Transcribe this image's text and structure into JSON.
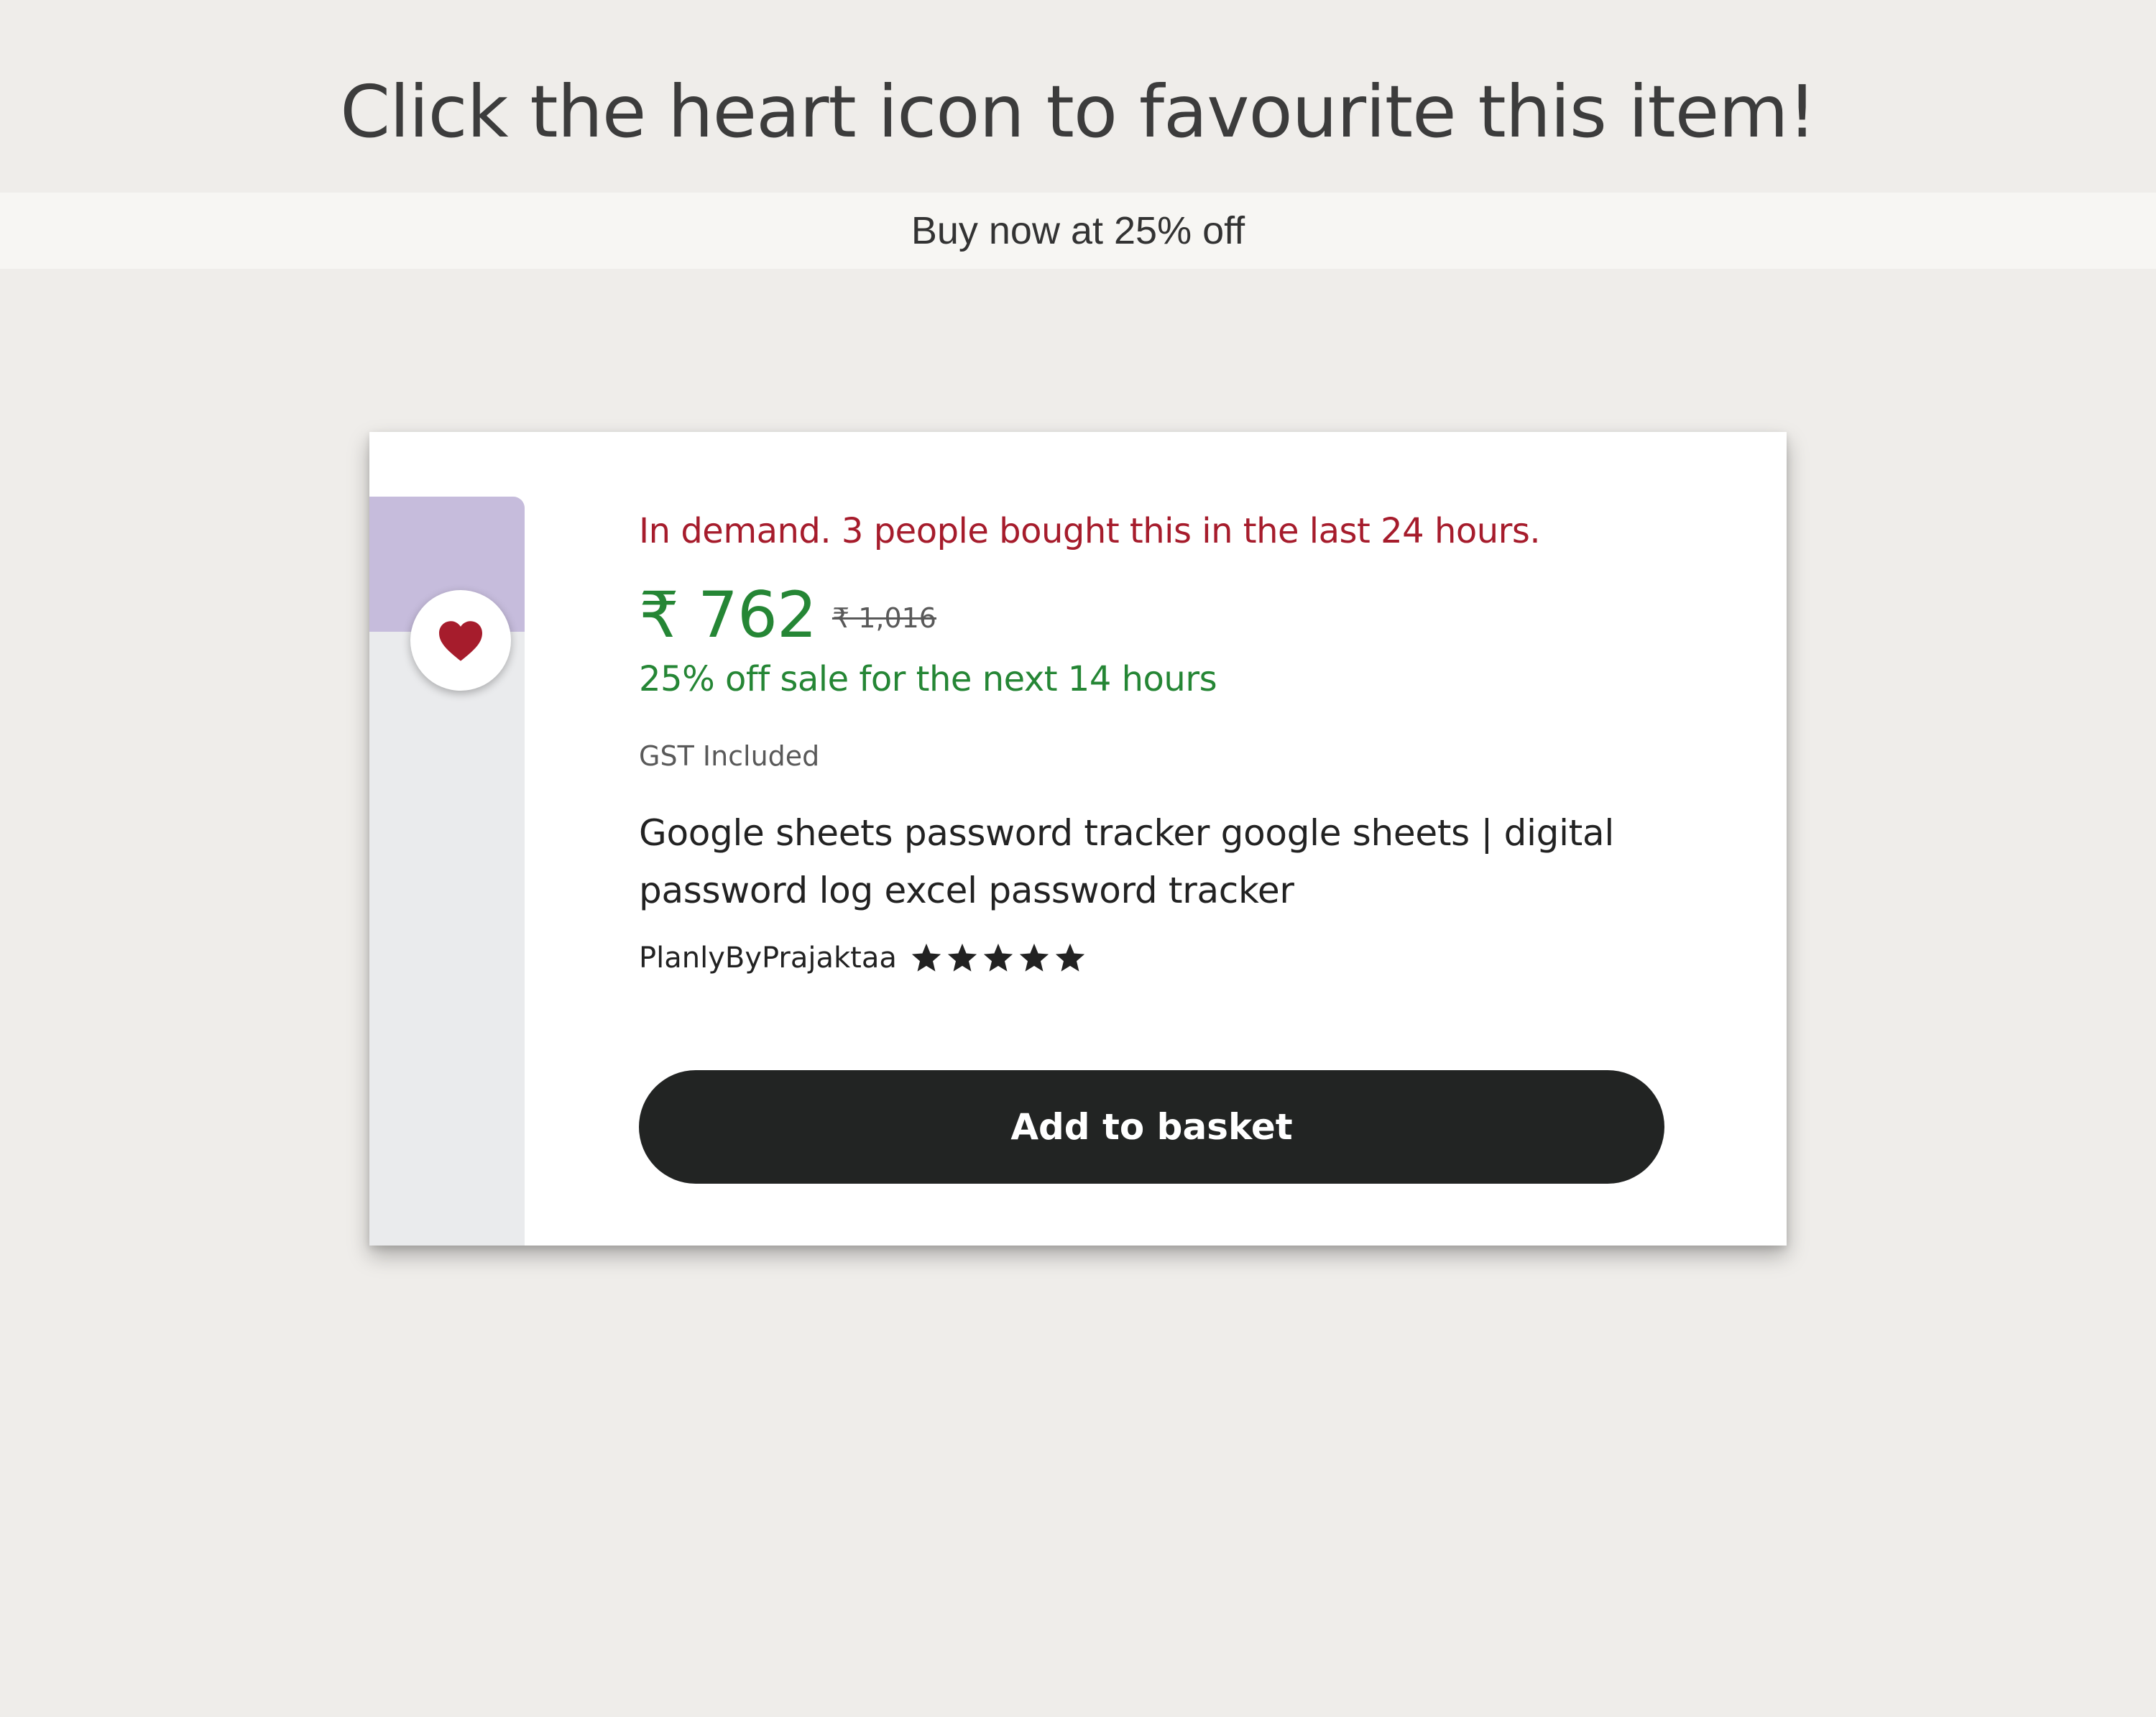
{
  "headline": "Click the heart icon to favourite this item!",
  "promo_banner": "Buy now at 25% off",
  "listing": {
    "demand_notice": "In demand. 3 people bought this in the last 24 hours.",
    "price": "₹ 762",
    "original_price": "₹ 1,016",
    "sale_message": "25% off sale for the next 14 hours",
    "tax_note": "GST Included",
    "title": "Google sheets password tracker google sheets | digital password log excel password tracker",
    "shop_name": "PlanlyByPrajaktaa",
    "rating_stars": 5,
    "add_to_basket_label": "Add to basket"
  },
  "icons": {
    "favourite": "heart-icon",
    "next_image": "chevron-right-icon",
    "rating": "star-icon"
  },
  "colors": {
    "demand_red": "#a61c2c",
    "sale_green": "#258635",
    "heart": "#a61c2c",
    "button_bg": "#222423",
    "thumbnail_tint": "#c6bcdc"
  }
}
